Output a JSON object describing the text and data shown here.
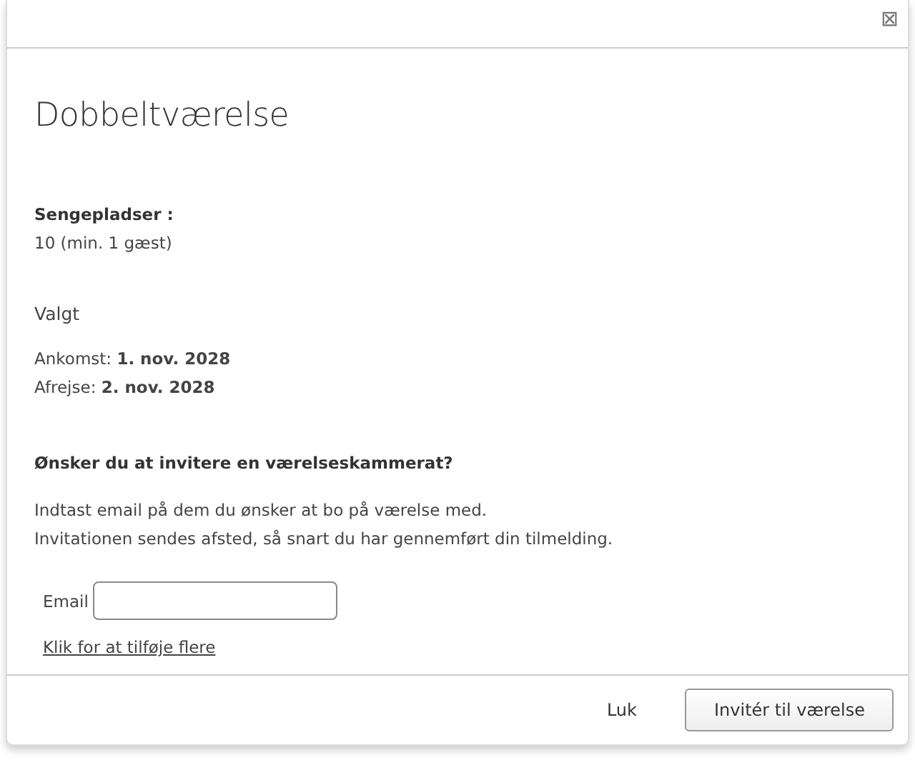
{
  "dialog": {
    "close_label": "⊠",
    "title": "Dobbeltværelse",
    "beds": {
      "label": "Sengepladser :",
      "value": "10 (min. 1 gæst)"
    },
    "selected_heading": "Valgt",
    "dates": [
      "Ankomst: **1. nov. 2028**",
      "Afrejse: **2. nov. 2028**"
    ],
    "invite": {
      "question": "Ønsker du at invitere en værelseskammerat?",
      "info": [
        "Indtast email på dem du ønsker at bo på værelse med.",
        "Invitationen sendes afsted, så snart du har gennemført din tilmelding."
      ],
      "email_label": "Email",
      "add_more_link": "Klik for at tilføje flere"
    },
    "buttons": [
      {
        "label": "Luk",
        "kind": "plain"
      },
      {
        "label": "Invitér til værelse",
        "kind": "outlined"
      }
    ]
  }
}
